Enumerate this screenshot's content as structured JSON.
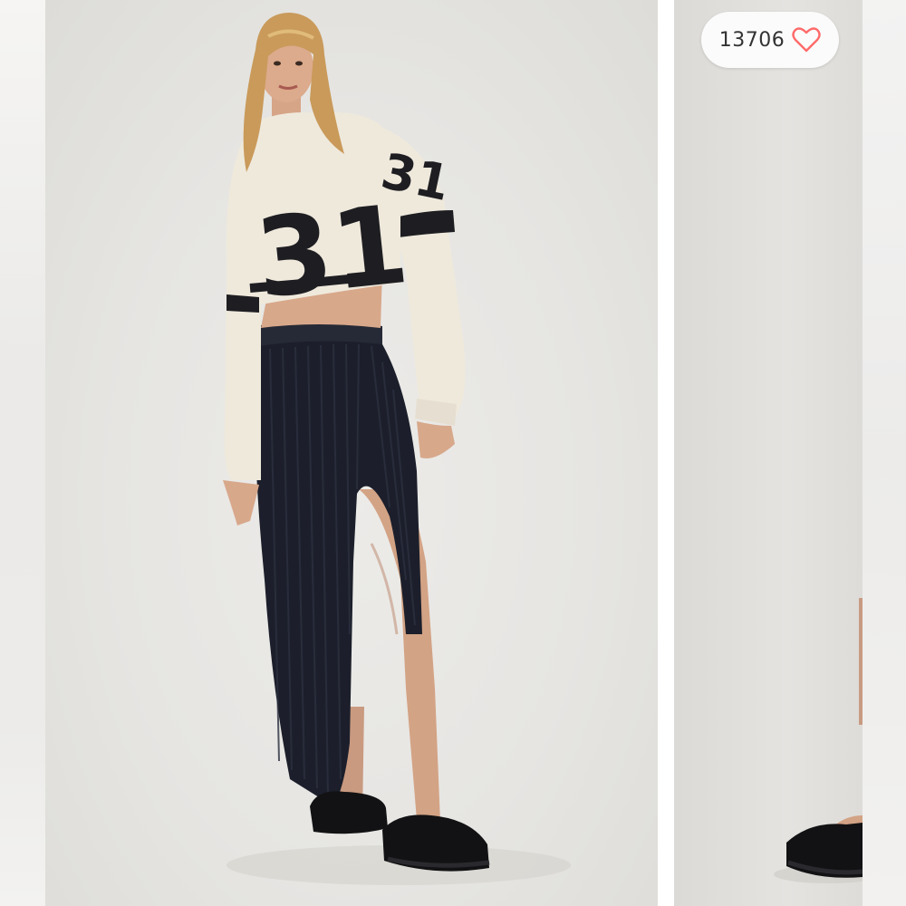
{
  "listing": {
    "likes_count": "13706",
    "like_icon": "heart-outline-icon",
    "like_color": "#ff6b6b"
  },
  "colors": {
    "background": "#e8e7e4",
    "skirt": "#1c1f2b",
    "sweatshirt": "#efe9dc",
    "numerals": "#1e1e22"
  },
  "images": [
    {
      "name": "product-photo-1",
      "subject": "model-in-cropped-sweatshirt-and-ribbed-maxi-skirt",
      "sweatshirt_print": "31"
    },
    {
      "name": "product-photo-2",
      "subject": "partial-view-sandal"
    }
  ]
}
